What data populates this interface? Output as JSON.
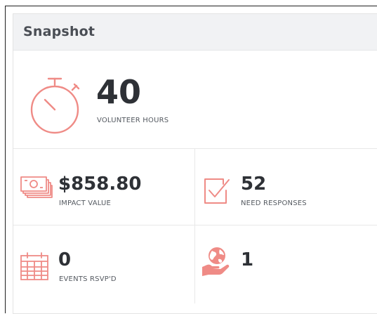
{
  "widget": {
    "title": "Snapshot",
    "accent_color": "#ef8b86"
  },
  "stats": {
    "volunteer_hours": {
      "value": "40",
      "label": "VOLUNTEER HOURS",
      "icon": "stopwatch-icon"
    },
    "impact_value": {
      "value": "$858.80",
      "label": "IMPACT VALUE",
      "icon": "money-stack-icon"
    },
    "need_responses": {
      "value": "52",
      "label": "NEED RESPONSES",
      "icon": "checkbox-check-icon"
    },
    "events_rsvpd": {
      "value": "0",
      "label": "EVENTS RSVP'D",
      "icon": "calendar-icon"
    },
    "globe_hand": {
      "value": "1",
      "icon": "globe-in-hand-icon"
    }
  }
}
